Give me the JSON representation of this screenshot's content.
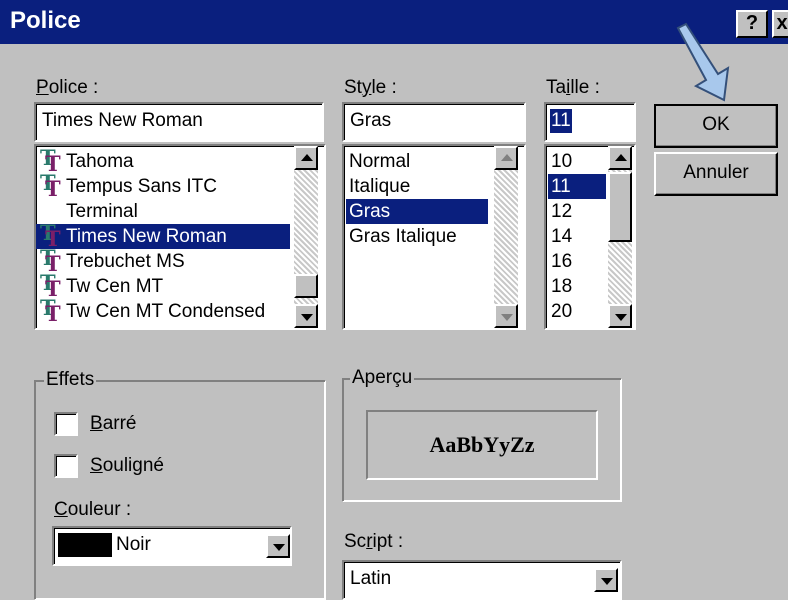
{
  "window": {
    "title": "Police",
    "help_label": "?",
    "close_label": "x"
  },
  "font": {
    "label": "Police :",
    "value": "Times New Roman",
    "items": [
      {
        "label": "Tahoma",
        "truetype": true
      },
      {
        "label": "Tempus Sans ITC",
        "truetype": true
      },
      {
        "label": "Terminal",
        "truetype": false
      },
      {
        "label": "Times New Roman",
        "truetype": true,
        "selected": true
      },
      {
        "label": "Trebuchet MS",
        "truetype": true
      },
      {
        "label": "Tw Cen MT",
        "truetype": true
      },
      {
        "label": "Tw Cen MT Condensed",
        "truetype": true
      }
    ]
  },
  "style": {
    "label": "Style :",
    "value": "Gras",
    "items": [
      "Normal",
      "Italique",
      "Gras",
      "Gras Italique"
    ],
    "selected": "Gras"
  },
  "size": {
    "label": "Taille :",
    "value": "11",
    "items": [
      "10",
      "11",
      "12",
      "14",
      "16",
      "18",
      "20"
    ],
    "selected": "11"
  },
  "buttons": {
    "ok": "OK",
    "cancel": "Annuler"
  },
  "effects": {
    "label": "Effets",
    "strikeout": {
      "label": "Barré",
      "checked": false
    },
    "underline": {
      "label": "Souligné",
      "checked": false
    },
    "color_label": "Couleur :",
    "color_value": "Noir",
    "color_swatch": "#000000"
  },
  "preview": {
    "label": "Aperçu",
    "sample": "AaBbYyZz"
  },
  "script": {
    "label": "Script :",
    "value": "Latin"
  },
  "colors": {
    "titlebar": "#0a1f7e",
    "selection": "#0a1f7e",
    "dialog": "#c0c0c0",
    "pointer_arrow": "#a8c8ec"
  }
}
